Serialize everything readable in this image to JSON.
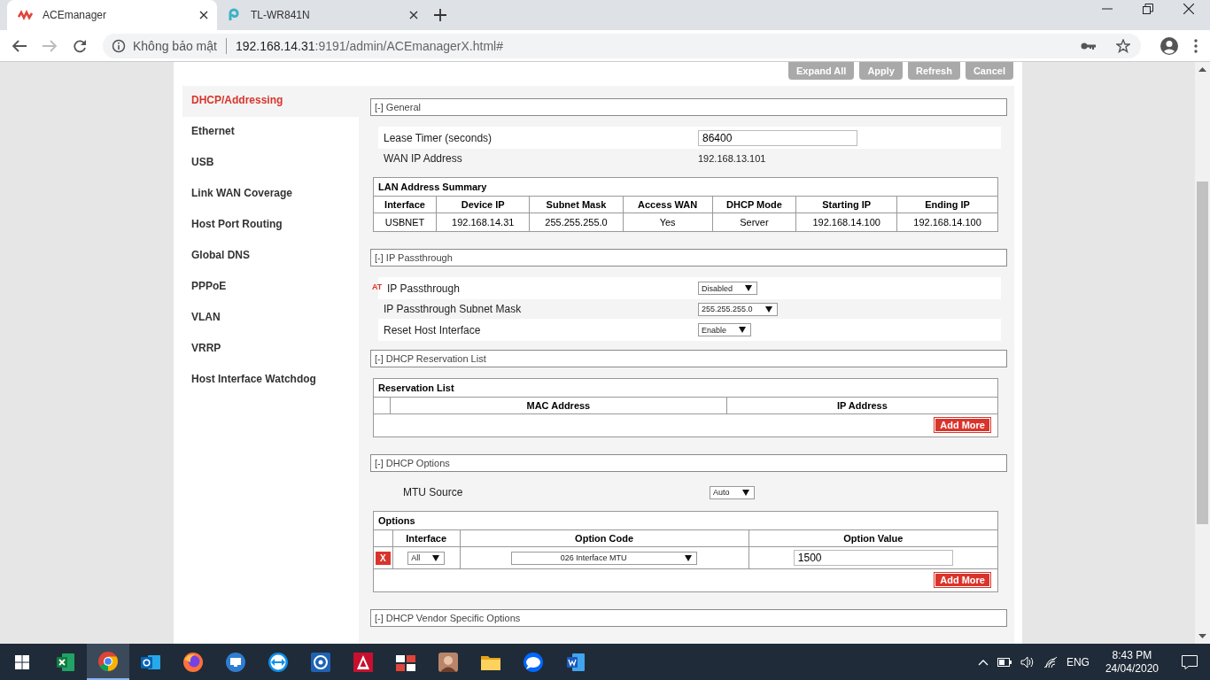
{
  "browser": {
    "tabs": [
      {
        "title": "ACEmanager",
        "selected": true,
        "kind": "ace"
      },
      {
        "title": "TL-WR841N",
        "selected": false,
        "kind": "tplink"
      }
    ],
    "address": {
      "security": "Không bảo mật",
      "host": "192.168.14.31",
      "path": ":9191/admin/ACEmanagerX.html#"
    },
    "forward_disabled": true
  },
  "toolbar": {
    "buttons": [
      "Expand All",
      "Apply",
      "Refresh",
      "Cancel"
    ]
  },
  "sidebar": {
    "items": [
      {
        "label": "DHCP/Addressing",
        "selected": true
      },
      {
        "label": "Ethernet",
        "selected": false
      },
      {
        "label": "USB",
        "selected": false
      },
      {
        "label": "Link WAN Coverage",
        "selected": false
      },
      {
        "label": "Host Port Routing",
        "selected": false
      },
      {
        "label": "Global DNS",
        "selected": false
      },
      {
        "label": "PPPoE",
        "selected": false
      },
      {
        "label": "VLAN",
        "selected": false
      },
      {
        "label": "VRRP",
        "selected": false
      },
      {
        "label": "Host Interface Watchdog",
        "selected": false
      }
    ]
  },
  "sections": [
    {
      "title": "[-] General",
      "blocks": [
        {
          "kind": "fields",
          "fields": [
            {
              "label": "Lease Timer (seconds)",
              "kind": "input",
              "value": "86400"
            },
            {
              "label": "WAN IP Address",
              "kind": "static",
              "value": "192.168.13.101"
            }
          ]
        },
        {
          "kind": "table",
          "caption": "LAN Address Summary",
          "columns": [
            "Interface",
            "Device IP",
            "Subnet Mask",
            "Access WAN",
            "DHCP Mode",
            "Starting IP",
            "Ending IP"
          ],
          "rows": [
            {
              "cells": [
                "USBNET",
                "192.168.14.31",
                "255.255.255.0",
                "Yes",
                "Server",
                "192.168.14.100",
                "192.168.14.100"
              ]
            }
          ]
        }
      ]
    },
    {
      "title": "[-] IP Passthrough",
      "blocks": [
        {
          "kind": "fields",
          "fields": [
            {
              "label": "IP Passthrough",
              "kind": "select",
              "value": "Disabled",
              "badge": "AT"
            },
            {
              "label": "IP Passthrough Subnet Mask",
              "kind": "select",
              "value": "255.255.255.0"
            },
            {
              "label": "Reset Host Interface",
              "kind": "select",
              "value": "Enable"
            }
          ]
        }
      ]
    },
    {
      "title": "[-] DHCP Reservation List",
      "blocks": [
        {
          "kind": "table",
          "caption": "Reservation List",
          "columns": [
            "MAC Address",
            "IP Address"
          ],
          "add_button": "Add More"
        }
      ]
    },
    {
      "title": "[-] DHCP Options",
      "blocks": [
        {
          "kind": "fields",
          "fields": [
            {
              "label": "MTU Source",
              "kind": "select",
              "value": "Auto"
            }
          ]
        },
        {
          "kind": "table",
          "caption": "Options",
          "columns": [
            "Interface",
            "Option Code",
            "Option Value"
          ],
          "rows": [
            {
              "action": "X",
              "cells": [
                {
                  "kind": "select",
                  "value": "All"
                },
                {
                  "kind": "select",
                  "value": "026 Interface MTU"
                },
                {
                  "kind": "input",
                  "value": "1500"
                }
              ]
            }
          ],
          "add_button": "Add More"
        }
      ]
    },
    {
      "title": "[-] DHCP Vendor Specific Options"
    }
  ],
  "taskbar": {
    "apps": [
      {
        "kind": "spreadsheet",
        "selected": false
      },
      {
        "kind": "chrome",
        "selected": true
      },
      {
        "kind": "mail",
        "selected": false
      },
      {
        "kind": "fox",
        "selected": false
      },
      {
        "kind": "monitor",
        "selected": false
      },
      {
        "kind": "arrows",
        "selected": false
      },
      {
        "kind": "gear",
        "selected": false
      },
      {
        "kind": "triangle",
        "selected": false
      },
      {
        "kind": "grid",
        "selected": false
      },
      {
        "kind": "portrait",
        "selected": false
      },
      {
        "kind": "folder",
        "selected": false
      },
      {
        "kind": "chat",
        "selected": false
      },
      {
        "kind": "document",
        "selected": false
      }
    ],
    "language": "ENG",
    "time": "8:43 PM",
    "date": "24/04/2020"
  }
}
